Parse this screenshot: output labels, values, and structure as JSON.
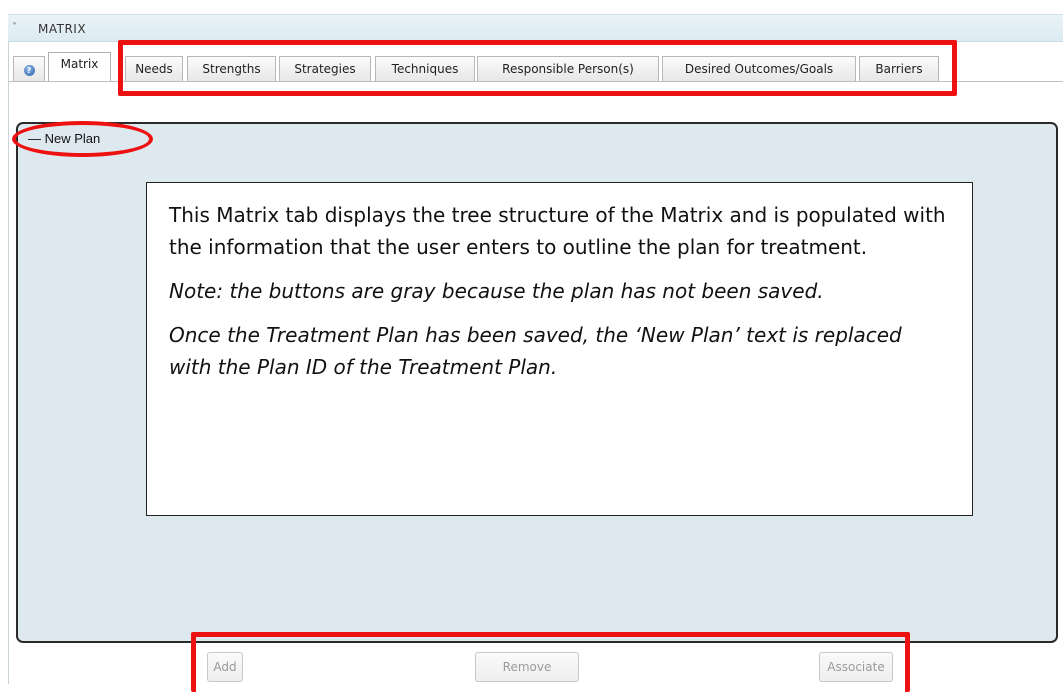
{
  "section": {
    "title": "MATRIX",
    "collapse_icon": "chevron-down-icon"
  },
  "tabs": [
    {
      "label": "",
      "icon": "help-icon"
    },
    {
      "label": "Matrix"
    },
    {
      "label": "Needs"
    },
    {
      "label": "Strengths"
    },
    {
      "label": "Strategies"
    },
    {
      "label": "Techniques"
    },
    {
      "label": "Responsible Person(s)"
    },
    {
      "label": "Desired Outcomes/Goals"
    },
    {
      "label": "Barriers"
    }
  ],
  "active_tab": "Matrix",
  "tree": {
    "root_label": "— New Plan"
  },
  "note": {
    "para1": "This Matrix tab displays the tree structure of the Matrix and is populated with the information that the user enters to outline the plan for treatment.",
    "para2": "Note: the buttons are gray because the plan has not been saved.",
    "para3": " Once the Treatment Plan has been saved, the ‘New Plan’ text is replaced with the Plan ID of the Treatment Plan."
  },
  "buttons": {
    "add": "Add",
    "remove": "Remove",
    "associate": "Associate"
  },
  "colors": {
    "highlight": "#ee1111",
    "panel_bg": "#dde9ee"
  }
}
